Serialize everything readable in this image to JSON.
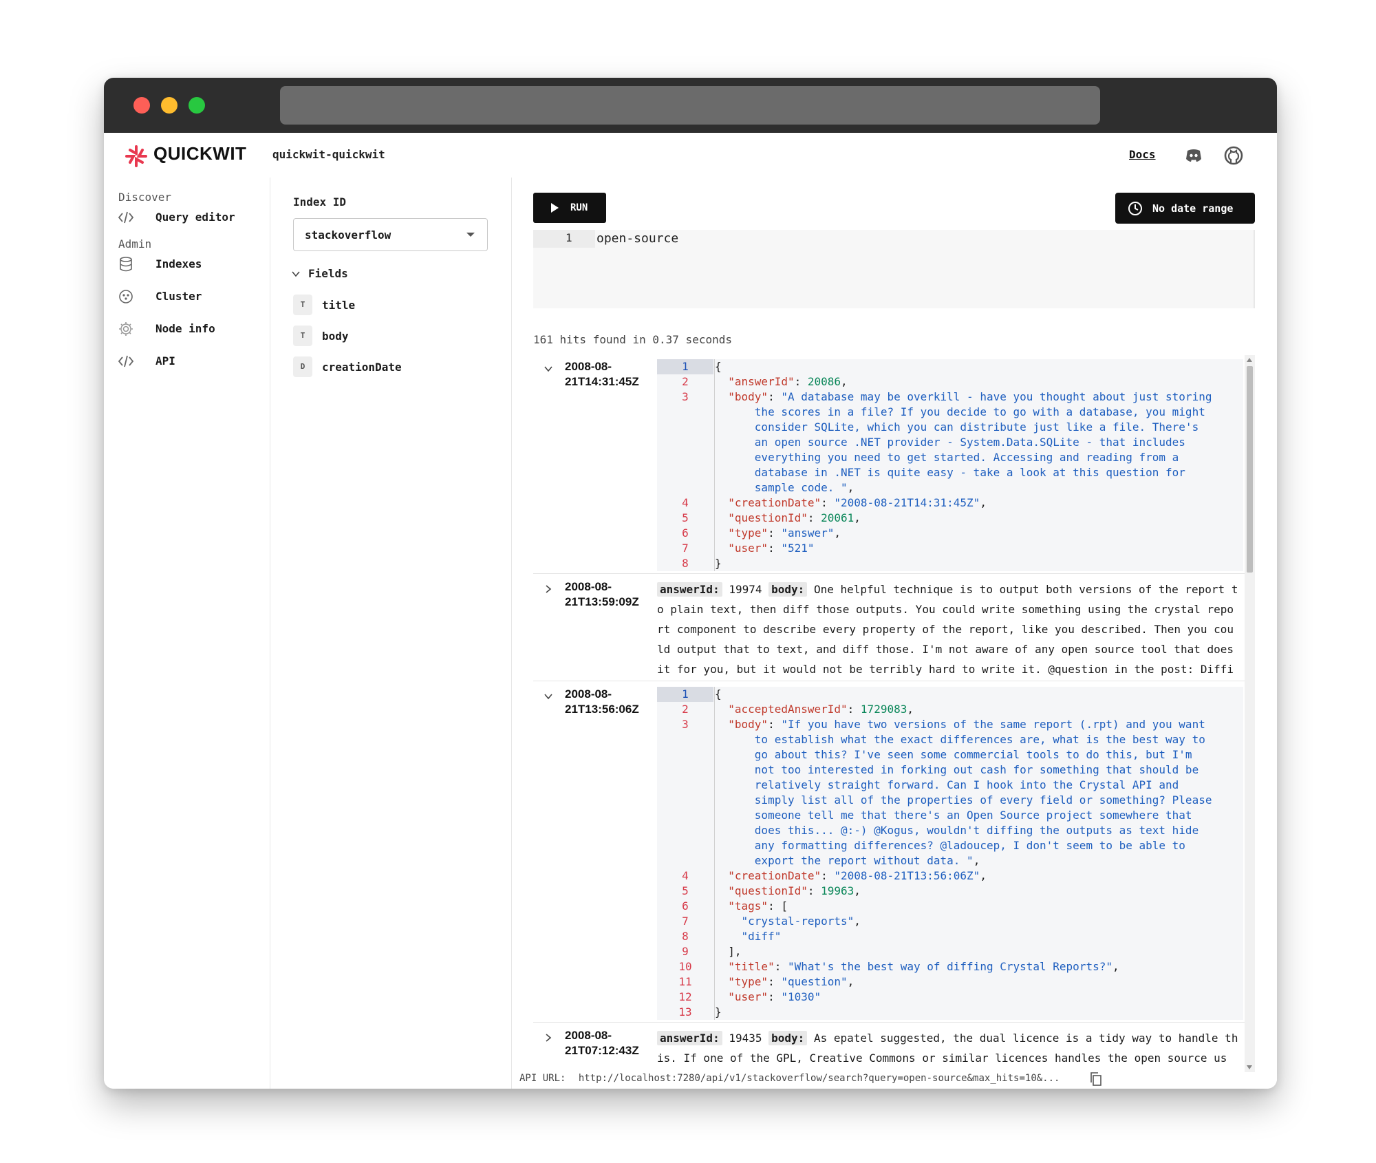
{
  "app": {
    "brand": "QUICKWIT",
    "cluster_name": "quickwit-quickwit",
    "docs_label": "Docs",
    "icons": {
      "logo": "quickwit-logo-icon",
      "discord": "discord-icon",
      "github": "github-icon"
    },
    "accent_color": "#e8384f"
  },
  "sidebar": {
    "discover_label": "Discover",
    "admin_label": "Admin",
    "items": [
      {
        "label": "Query editor",
        "icon": "code-icon"
      },
      {
        "label": "Indexes",
        "icon": "database-icon"
      },
      {
        "label": "Cluster",
        "icon": "cluster-icon"
      },
      {
        "label": "Node info",
        "icon": "gear-icon"
      },
      {
        "label": "API",
        "icon": "code-icon"
      }
    ]
  },
  "fields_panel": {
    "index_label": "Index ID",
    "index_value": "stackoverflow",
    "fields_label": "Fields",
    "fields": [
      {
        "type": "T",
        "name": "title"
      },
      {
        "type": "T",
        "name": "body"
      },
      {
        "type": "D",
        "name": "creationDate"
      }
    ]
  },
  "toolbar": {
    "run_label": "RUN",
    "date_range_label": "No date range"
  },
  "editor": {
    "line_number": "1",
    "query": "open-source"
  },
  "results": {
    "hits_text": "161 hits found in 0.37 seconds",
    "rows": [
      {
        "ts_line1": "2008-08-",
        "ts_line2": "21T14:31:45Z",
        "expanded": true,
        "lines": [
          {
            "n": "1",
            "html": "<span class=\"p\">{</span>"
          },
          {
            "n": "2",
            "html": "  <span class=\"k\">\"answerId\"</span><span class=\"p\">: </span><span class=\"num\">20086</span><span class=\"p\">,</span>"
          },
          {
            "n": "3",
            "html": "  <span class=\"k\">\"body\"</span><span class=\"p\">: </span><span class=\"s\">\"A database may be overkill - have you thought about just storing</span>"
          },
          {
            "n": "",
            "html": "      <span class=\"s\">the scores in a file? If you decide to go with a database, you might</span>"
          },
          {
            "n": "",
            "html": "      <span class=\"s\">consider SQLite, which you can distribute just like a file. There's</span>"
          },
          {
            "n": "",
            "html": "      <span class=\"s\">an open source .NET provider - System.Data.SQLite - that includes</span>"
          },
          {
            "n": "",
            "html": "      <span class=\"s\">everything you need to get started. Accessing and reading from a</span>"
          },
          {
            "n": "",
            "html": "      <span class=\"s\">database in .NET is quite easy - take a look at this question for</span>"
          },
          {
            "n": "",
            "html": "      <span class=\"s\">sample code. \"</span><span class=\"p\">,</span>"
          },
          {
            "n": "4",
            "html": "  <span class=\"k\">\"creationDate\"</span><span class=\"p\">: </span><span class=\"s\">\"2008-08-21T14:31:45Z\"</span><span class=\"p\">,</span>"
          },
          {
            "n": "5",
            "html": "  <span class=\"k\">\"questionId\"</span><span class=\"p\">: </span><span class=\"num\">20061</span><span class=\"p\">,</span>"
          },
          {
            "n": "6",
            "html": "  <span class=\"k\">\"type\"</span><span class=\"p\">: </span><span class=\"s\">\"answer\"</span><span class=\"p\">,</span>"
          },
          {
            "n": "7",
            "html": "  <span class=\"k\">\"user\"</span><span class=\"p\">: </span><span class=\"s\">\"521\"</span>"
          },
          {
            "n": "8",
            "html": "<span class=\"p\">}</span>"
          }
        ]
      },
      {
        "ts_line1": "2008-08-",
        "ts_line2": "21T13:59:09Z",
        "expanded": false,
        "tags": [
          "answerId:",
          "body:"
        ],
        "answer_id": "19974",
        "body": "One helpful technique is to output both versions of the report to plain text, then diff those outputs. You could write something using the crystal report component to describe every property of the report, like you described. Then you could output that to text, and diff those. I'm not aware of any open source tool that does it for you, but it would not be terribly hard to write it. @question in the post: Diffi"
      },
      {
        "ts_line1": "2008-08-",
        "ts_line2": "21T13:56:06Z",
        "expanded": true,
        "lines": [
          {
            "n": "1",
            "html": "<span class=\"p\">{</span>"
          },
          {
            "n": "2",
            "html": "  <span class=\"k\">\"acceptedAnswerId\"</span><span class=\"p\">: </span><span class=\"num\">1729083</span><span class=\"p\">,</span>"
          },
          {
            "n": "3",
            "html": "  <span class=\"k\">\"body\"</span><span class=\"p\">: </span><span class=\"s\">\"If you have two versions of the same report (.rpt) and you want</span>"
          },
          {
            "n": "",
            "html": "      <span class=\"s\">to establish what the exact differences are, what is the best way to</span>"
          },
          {
            "n": "",
            "html": "      <span class=\"s\">go about this? I've seen some commercial tools to do this, but I'm</span>"
          },
          {
            "n": "",
            "html": "      <span class=\"s\">not too interested in forking out cash for something that should be</span>"
          },
          {
            "n": "",
            "html": "      <span class=\"s\">relatively straight forward. Can I hook into the Crystal API and</span>"
          },
          {
            "n": "",
            "html": "      <span class=\"s\">simply list all of the properties of every field or something? Please</span>"
          },
          {
            "n": "",
            "html": "      <span class=\"s\">someone tell me that there's an Open Source project somewhere that</span>"
          },
          {
            "n": "",
            "html": "      <span class=\"s\">does this... @:-) @Kogus, wouldn't diffing the outputs as text hide</span>"
          },
          {
            "n": "",
            "html": "      <span class=\"s\">any formatting differences? @ladoucep, I don't seem to be able to</span>"
          },
          {
            "n": "",
            "html": "      <span class=\"s\">export the report without data. \"</span><span class=\"p\">,</span>"
          },
          {
            "n": "4",
            "html": "  <span class=\"k\">\"creationDate\"</span><span class=\"p\">: </span><span class=\"s\">\"2008-08-21T13:56:06Z\"</span><span class=\"p\">,</span>"
          },
          {
            "n": "5",
            "html": "  <span class=\"k\">\"questionId\"</span><span class=\"p\">: </span><span class=\"num\">19963</span><span class=\"p\">,</span>"
          },
          {
            "n": "6",
            "html": "  <span class=\"k\">\"tags\"</span><span class=\"p\">: [</span>"
          },
          {
            "n": "7",
            "html": "    <span class=\"s\">\"crystal-reports\"</span><span class=\"p\">,</span>"
          },
          {
            "n": "8",
            "html": "    <span class=\"s\">\"diff\"</span>"
          },
          {
            "n": "9",
            "html": "  <span class=\"p\">],</span>"
          },
          {
            "n": "10",
            "html": "  <span class=\"k\">\"title\"</span><span class=\"p\">: </span><span class=\"s\">\"What's the best way of diffing Crystal Reports?\"</span><span class=\"p\">,</span>"
          },
          {
            "n": "11",
            "html": "  <span class=\"k\">\"type\"</span><span class=\"p\">: </span><span class=\"s\">\"question\"</span><span class=\"p\">,</span>"
          },
          {
            "n": "12",
            "html": "  <span class=\"k\">\"user\"</span><span class=\"p\">: </span><span class=\"s\">\"1030\"</span>"
          },
          {
            "n": "13",
            "html": "<span class=\"p\">}</span>"
          }
        ]
      },
      {
        "ts_line1": "2008-08-",
        "ts_line2": "21T07:12:43Z",
        "expanded": false,
        "tags": [
          "answerId:",
          "body:"
        ],
        "answer_id": "19435",
        "body": "As epatel suggested, the dual licence is a tidy way to handle this. If one of the GPL, Creative Commons or similar licences handles the open source use, then you're set on that side. And you can probably find a commercial licence close t"
      }
    ]
  },
  "api": {
    "label": "API URL:",
    "url": "http://localhost:7280/api/v1/stackoverflow/search?query=open-source&max_hits=10&...",
    "copy_icon": "copy-icon"
  }
}
